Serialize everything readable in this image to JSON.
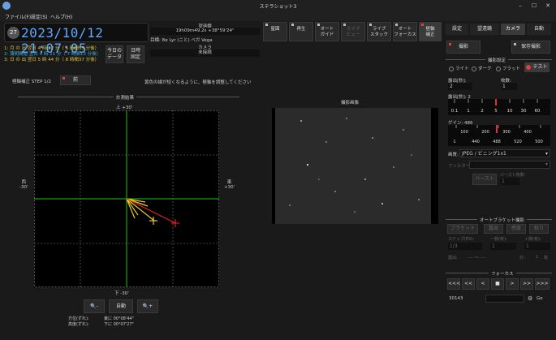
{
  "window": {
    "title": "ステラショット3",
    "min": "–",
    "max": "☐",
    "close": "✕"
  },
  "menu": [
    "ファイル(F)",
    "設定(S)",
    "ヘルプ(H)"
  ],
  "datetime": {
    "moon_age": "27",
    "text": "2023/10/12 21:07:05"
  },
  "sun_moon": [
    {
      "text": "1: 月 の 出  翌日  4 時 02 分（ 6 時間55 分後）",
      "color": "#e0c040"
    },
    {
      "text": "2: 薄明開始  翌日  4 時 21 分（ 7 時間13 分後）",
      "color": "#40b0e0"
    },
    {
      "text": "3: 日 の 出  翌日  5 時 44 分（ 8 時間37 分後）",
      "color": "#e0c040"
    }
  ],
  "buttons_left": {
    "today_data": "今日の\nデータ",
    "time_fix": "日時\n固定"
  },
  "telescope": {
    "header": "望遠鏡",
    "coords": "19h09m49.2s  +38°59'24\"",
    "target": "目標: 8α Lyr (こと) ベガ Vega",
    "camera_header": "カメラ",
    "camera_status": "未接続"
  },
  "toolbar": [
    {
      "label": "星図",
      "state": "normal"
    },
    {
      "label": "再生",
      "state": "normal"
    },
    {
      "label": "オート\nガイド",
      "state": "normal"
    },
    {
      "label": "ライブ\nビュー",
      "state": "disabled"
    },
    {
      "label": "ライブ\nスタック",
      "state": "normal"
    },
    {
      "label": "オート\nフォーカス",
      "state": "normal"
    },
    {
      "label": "極軸\n補正",
      "state": "active"
    }
  ],
  "polar": {
    "step": "極軸補正 STEP 1/2",
    "prev": "前",
    "instruction": "黄色の線が短くなるように、極軸を調整してください",
    "result_title": "計測結果",
    "top_label": "上 +30'",
    "bottom_label": "下 -30'",
    "left_label": "西\n-30'",
    "right_label": "東\n+30'",
    "zoom_out": "🔍-",
    "auto": "自動",
    "zoom_in": "🔍+",
    "offset_az": "方位(ずれ):\n高度(ずれ):",
    "offset_values": "東に 00°08'44\"\n下に 00°07'27\""
  },
  "preview": {
    "title": "撮影画像"
  },
  "right_tabs": [
    {
      "label": "設定",
      "active": false
    },
    {
      "label": "望遠鏡",
      "active": false
    },
    {
      "label": "カメラ",
      "active": true
    },
    {
      "label": "自動",
      "active": false
    }
  ],
  "capture": {
    "shoot": "撮影",
    "save": "保存撮影",
    "settings_title": "撮影設定",
    "modes": [
      "ライト",
      "ダーク",
      "フラット",
      "テスト"
    ],
    "exposure_label": "露出[秒]:",
    "exposure_value": "2",
    "count_label": "枚数:",
    "count_value": "1",
    "exposure_slider_label": "露出[秒]: 2",
    "exposure_ticks": [
      "0.1",
      "1",
      "2",
      "5",
      "10",
      "30",
      "60"
    ],
    "gain_label": "ゲイン: 486",
    "gain_ticks": [
      "100",
      "200",
      "300",
      "400"
    ],
    "gain_ticks2": [
      "1",
      "440",
      "488",
      "520",
      "500"
    ],
    "quality_label": "画質:",
    "quality_value": "JPEG / ビニング1x1",
    "filter_label": "フィルター:",
    "burst": "バースト",
    "burst_count_label": "バースト枚数:",
    "burst_count_value": "1"
  },
  "auto_bracket": {
    "title": "オートブラケット撮影",
    "buttons": [
      "ブラケット",
      "露出",
      "感度",
      "絞り"
    ],
    "step_label": "ステップ(EV):",
    "step_value": "1/3",
    "minus_label": "ー側(枚):",
    "plus_label": "＋側(枚):",
    "minus_value": "1",
    "plus_value": "1",
    "exposure_label": "露出:",
    "range": "---- 〜 ----",
    "total_label": "計:",
    "total_value": "1",
    "unit": "枚"
  },
  "focus": {
    "title": "フォーカス",
    "controls": [
      "<<<",
      "<<",
      "<",
      "■",
      ">",
      ">>",
      ">>>"
    ],
    "position": "30143",
    "go": "Go"
  }
}
